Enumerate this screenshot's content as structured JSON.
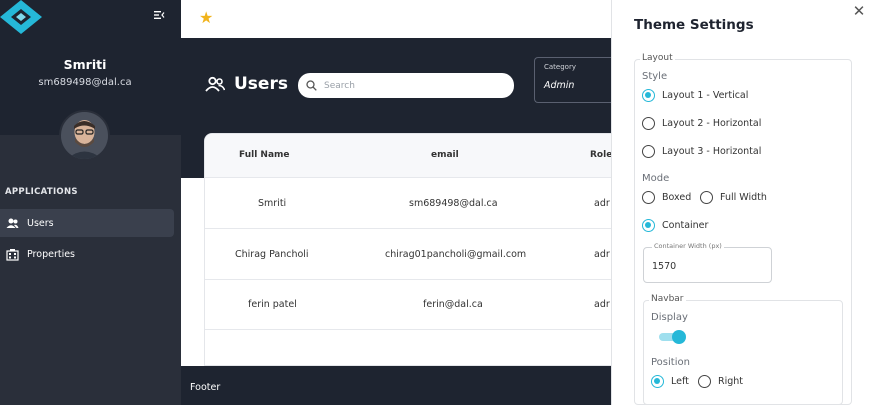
{
  "sidebar": {
    "user_name": "Smriti",
    "user_email": "sm689498@dal.ca",
    "section_label": "APPLICATIONS",
    "items": [
      {
        "label": "Users",
        "icon": "users-icon",
        "active": true
      },
      {
        "label": "Properties",
        "icon": "building-icon",
        "active": false
      }
    ]
  },
  "topbar": {
    "favorite_icon": "star-icon"
  },
  "header": {
    "title": "Users",
    "search_placeholder": "Search",
    "category_label": "Category",
    "category_value": "Admin"
  },
  "table": {
    "columns": [
      "Full Name",
      "email",
      "Role"
    ],
    "rows": [
      [
        "Smriti",
        "sm689498@dal.ca",
        "adr"
      ],
      [
        "Chirag Pancholi",
        "chirag01pancholi@gmail.com",
        "adr"
      ],
      [
        "ferin patel",
        "ferin@dal.ca",
        "adr"
      ]
    ]
  },
  "footer": {
    "text": "Footer"
  },
  "theme": {
    "title": "Theme Settings",
    "layout_legend": "Layout",
    "style_label": "Style",
    "styles": [
      {
        "label": "Layout 1 - Vertical",
        "checked": true
      },
      {
        "label": "Layout 2 - Horizontal",
        "checked": false
      },
      {
        "label": "Layout 3 - Horizontal",
        "checked": false
      }
    ],
    "mode_label": "Mode",
    "modes": [
      {
        "label": "Boxed",
        "checked": false
      },
      {
        "label": "Full Width",
        "checked": false
      },
      {
        "label": "Container",
        "checked": true
      }
    ],
    "container_width_label": "Container Width (px)",
    "container_width_value": "1570",
    "navbar_legend": "Navbar",
    "display_label": "Display",
    "display_on": true,
    "position_label": "Position",
    "positions": [
      {
        "label": "Left",
        "checked": true
      },
      {
        "label": "Right",
        "checked": false
      }
    ]
  },
  "colors": {
    "sidebar_bg": "#2a2f3a",
    "header_bg": "#1e2430",
    "accent": "#25b8d8",
    "star": "#f1b31c"
  }
}
